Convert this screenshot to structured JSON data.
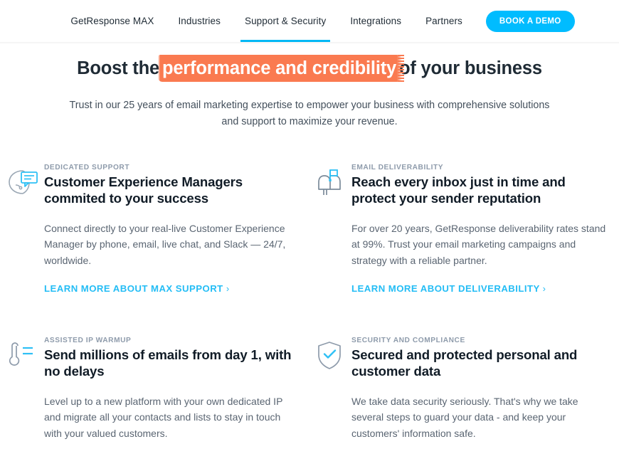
{
  "header": {
    "nav_items": [
      {
        "label": "GetResponse MAX",
        "active": false
      },
      {
        "label": "Industries",
        "active": false
      },
      {
        "label": "Support & Security",
        "active": true
      },
      {
        "label": "Integrations",
        "active": false
      },
      {
        "label": "Partners",
        "active": false
      }
    ],
    "cta_label": "BOOK A DEMO",
    "accent_color": "#00bcff",
    "active_underline_color": "#00b8f5"
  },
  "hero": {
    "title_before": "Boost the",
    "title_highlight": "performance and credibility",
    "title_after": "of your business",
    "highlight_color": "#fa7a50",
    "subtitle": "Trust in our 25 years of email marketing expertise to empower your business with comprehensive solutions and support to maximize your revenue."
  },
  "features": [
    {
      "icon": "head-chat-bubble-icon",
      "eyebrow": "DEDICATED SUPPORT",
      "title": "Customer Experience Managers commited to your success",
      "text": "Connect directly to your real-live Customer Experience Manager by phone, email, live chat, and Slack — 24/7, worldwide.",
      "link_label": "LEARN MORE ABOUT MAX SUPPORT",
      "link_chevron": "›"
    },
    {
      "icon": "mailbox-icon",
      "eyebrow": "EMAIL DELIVERABILITY",
      "title": "Reach every inbox just in time and protect your sender reputation",
      "text": "For over 20 years, GetResponse deliverability rates stand at 99%. Trust your email marketing campaigns and strategy with a reliable partner.",
      "link_label": "LEARN MORE ABOUT DELIVERABILITY",
      "link_chevron": "›"
    },
    {
      "icon": "thermometer-icon",
      "eyebrow": "ASSISTED IP WARMUP",
      "title": "Send millions of emails from day 1, with no delays",
      "text": "Level up to a new platform with your own dedicated IP and migrate all your contacts and lists to stay in touch with your valued customers.",
      "link_label": "",
      "link_chevron": ""
    },
    {
      "icon": "shield-check-icon",
      "eyebrow": "SECURITY AND COMPLIANCE",
      "title": "Secured and protected personal and customer data",
      "text": "We take data security seriously. That's why we take several steps to guard your data - and keep your customers' information safe.",
      "link_label": "",
      "link_chevron": ""
    }
  ]
}
